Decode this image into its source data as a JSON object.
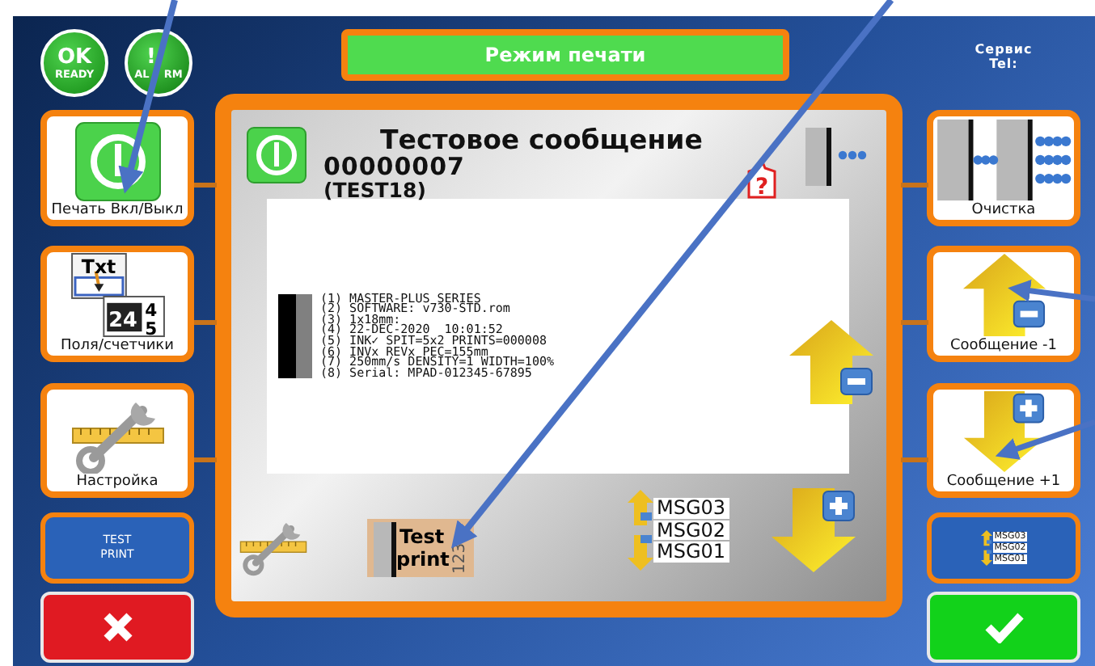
{
  "status_indicators": [
    {
      "kind": "ok",
      "symbol": "OK",
      "label_parts": [
        "READY"
      ]
    },
    {
      "kind": "alarm",
      "symbol": "!",
      "label_parts": [
        "AL",
        "RM"
      ]
    }
  ],
  "mode_title": "Режим печати",
  "service": {
    "line_1": "Сервис",
    "line_2": "Tel:"
  },
  "left_buttons": [
    {
      "kind": "power",
      "label": "Печать Вкл/Выкл"
    },
    {
      "kind": "fields",
      "label": "Поля/счетчики",
      "icon_texts": [
        "Txt",
        "24",
        "4",
        "5"
      ]
    },
    {
      "kind": "setup",
      "label": "Настройка"
    }
  ],
  "test_print_button": {
    "line_1": "TEST",
    "line_2": "PRINT"
  },
  "message": {
    "title": "Тестовое сообщение",
    "number": "00000007",
    "name": "(TEST18)",
    "help_mark": "?",
    "preview_lines": [
      "(1) MASTER-PLUS SERIES",
      "(2) SOFTWARE: v730-STD.rom",
      "(3) 1x18mm:",
      "(4) 22-DEC-2020  10:01:52",
      "(5) INK✓ SPIT=5x2 PRINTS=000008",
      "(6) INVx REVx PEC=155mm",
      "(7) 250mm/s DENSITY=1 WIDTH=100%",
      "(8) Serial: MPAD-012345-67895"
    ]
  },
  "test_print_icon": {
    "line_1": "Test",
    "line_2": "print",
    "digits": "123"
  },
  "message_list": [
    "MSG03",
    "MSG02",
    "MSG01"
  ],
  "right_buttons": [
    {
      "kind": "purge",
      "label": "Очистка"
    },
    {
      "kind": "prev",
      "label": "Сообщение -1"
    },
    {
      "kind": "next",
      "label": "Сообщение +1"
    }
  ],
  "message_list_button": [
    "MSG03",
    "MSG02",
    "MSG01"
  ]
}
